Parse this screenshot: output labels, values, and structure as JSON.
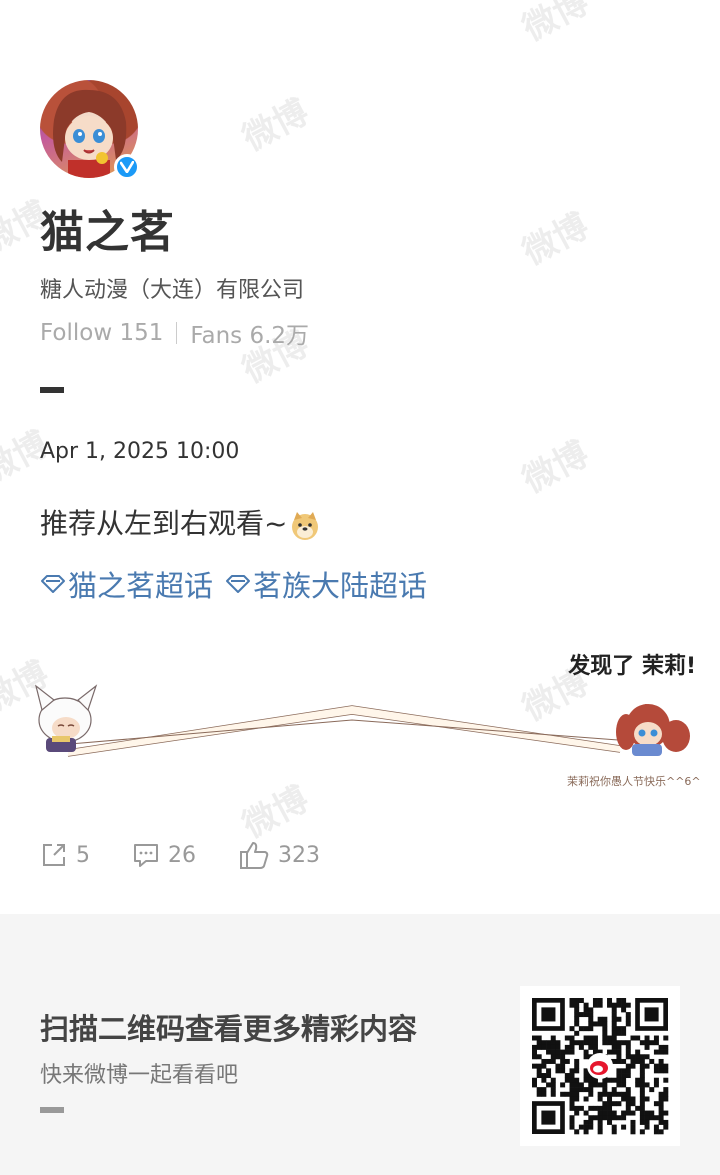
{
  "profile": {
    "name": "猫之茗",
    "company": "糖人动漫（大连）有限公司",
    "follow_label": "Follow 151",
    "fans_label": "Fans 6.2万"
  },
  "post": {
    "date": "Apr 1, 2025 10:00",
    "text": "推荐从左到右观看~",
    "tags": [
      "猫之茗超话",
      "茗族大陆超话"
    ],
    "illustration_caption": "发现了 茉莉!",
    "illustration_small_text": "茉莉祝你愚人节快乐^^6^"
  },
  "actions": {
    "reposts": "5",
    "comments": "26",
    "likes": "323"
  },
  "footer": {
    "title": "扫描二维码查看更多精彩内容",
    "subtitle": "快来微博一起看看吧"
  },
  "watermark_text": "微博",
  "colors": {
    "tag_blue": "#4a7ab0",
    "verified_blue": "#1b9af7",
    "footer_bg": "#f5f5f5"
  }
}
